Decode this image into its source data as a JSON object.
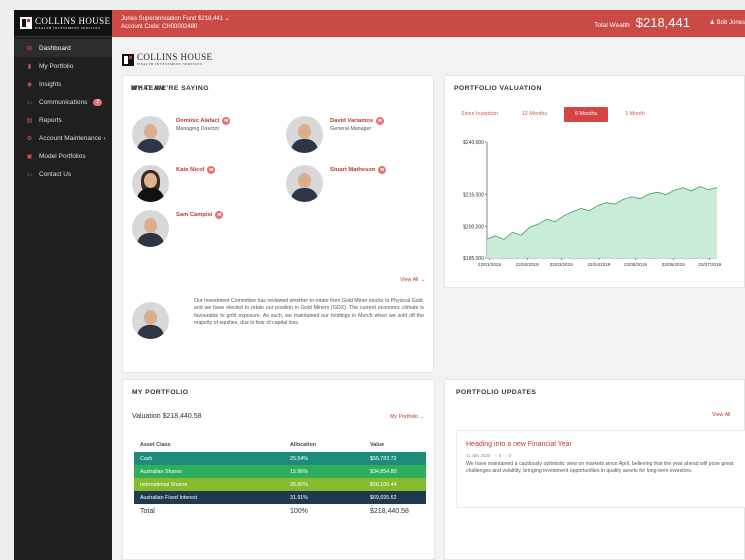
{
  "brand": {
    "name": "COLLINS HOUSE",
    "tagline": "WEALTH INVESTMENT SERVICES"
  },
  "account": {
    "fund": "Jones Superannuation Fund $218,441 ⌄",
    "code": "Account Code: CH00002480"
  },
  "total_wealth": {
    "label": "Total Wealth",
    "amount": "$218,441"
  },
  "user": "♟ Bob Jones",
  "sidebar": {
    "items": [
      {
        "label": "Dashboard",
        "icon": "grid-icon",
        "glyph": "⊞"
      },
      {
        "label": "My Portfolio",
        "icon": "bar-chart-icon",
        "glyph": "▮"
      },
      {
        "label": "Insights",
        "icon": "eye-icon",
        "glyph": "◉"
      },
      {
        "label": "Communications",
        "icon": "chat-icon",
        "glyph": "▭",
        "badge": "2"
      },
      {
        "label": "Reports",
        "icon": "document-icon",
        "glyph": "▤"
      },
      {
        "label": "Account Maintenance ›",
        "icon": "gear-icon",
        "glyph": "⚙"
      },
      {
        "label": "Model Portfolios",
        "icon": "briefcase-icon",
        "glyph": "▣"
      },
      {
        "label": "Contact Us",
        "icon": "message-icon",
        "glyph": "▭"
      }
    ]
  },
  "team": {
    "title": "MY TEAM",
    "members": [
      {
        "name": "Dominic Alafaci",
        "role": "Managing Director"
      },
      {
        "name": "David Variamos",
        "role": "General Manager"
      },
      {
        "name": "Kate Nicol",
        "role": ""
      },
      {
        "name": "Stuart Matheson",
        "role": ""
      },
      {
        "name": "Sam Campisi",
        "role": ""
      }
    ]
  },
  "saying": {
    "title": "WHAT WE'RE SAYING",
    "view_all": "View All →",
    "text": "Our Investment Committee has reviewed whether to rotate from Gold Miner stocks to Physical Gold, and we have elected to retain our position in Gold Miners (GDX). The current economic climate is favourable to gold exposure. As such, we maintained our holdings in Merch when we sold off the majority of equities, due to fear of capital loss."
  },
  "valuation": {
    "title": "PORTFOLIO VALUATION",
    "tabs": [
      "Since Inception",
      "12 Months",
      "6 Months",
      "1 Month"
    ],
    "active_tab": "6 Months"
  },
  "chart_data": {
    "type": "area",
    "title": "",
    "xlabel": "",
    "ylabel": "",
    "ylim": [
      185000,
      240000
    ],
    "y_ticks": [
      "$240,000",
      "$215,000",
      "$200,000",
      "$185,000"
    ],
    "y_tick_values": [
      240000,
      215000,
      200000,
      185000
    ],
    "x_ticks": [
      "22/01/2019",
      "22/02/2019",
      "22/03/2019",
      "22/04/2019",
      "22/05/2019",
      "22/06/2019",
      "22/07/2019"
    ],
    "color": "#c9ecd6",
    "line_color": "#3a9c6a",
    "grid": false,
    "series": [
      {
        "x": [
          "20/01/2019",
          "27/01/2019",
          "03/02/2019",
          "10/02/2019",
          "17/02/2019",
          "24/02/2019",
          "03/03/2019",
          "10/03/2019",
          "17/03/2019",
          "24/03/2019",
          "31/03/2019",
          "07/04/2019",
          "14/04/2019",
          "21/04/2019",
          "28/04/2019",
          "05/05/2019",
          "12/05/2019",
          "19/05/2019",
          "26/05/2019",
          "02/06/2019",
          "09/06/2019",
          "16/06/2019",
          "23/06/2019",
          "30/06/2019",
          "07/07/2019",
          "14/07/2019",
          "21/07/2019",
          "28/07/2019"
        ],
        "values": [
          194000,
          195500,
          193800,
          197200,
          195800,
          199500,
          201000,
          203400,
          202200,
          205000,
          206800,
          208500,
          207400,
          209800,
          211200,
          210500,
          212800,
          214000,
          213100,
          215300,
          216200,
          215000,
          217200,
          218300,
          216800,
          218900,
          217400,
          218441
        ]
      }
    ]
  },
  "portfolio": {
    "title": "MY PORTFOLIO",
    "valuation": "Valuation $218,440.58",
    "link": "My Portfolio →",
    "headers": [
      "Asset Class",
      "Allocation",
      "Value"
    ],
    "rows": [
      {
        "asset": "Cash",
        "allocation": "25.54%",
        "value": "$55,783.72",
        "color": "#1e8c7a"
      },
      {
        "asset": "Australian Shares",
        "allocation": "15.96%",
        "value": "$34,854.80",
        "color": "#2eae5c"
      },
      {
        "asset": "International Shares",
        "allocation": "26.60%",
        "value": "$58,106.44",
        "color": "#86bb2d"
      },
      {
        "asset": "Australian Fixed Interest",
        "allocation": "31.91%",
        "value": "$69,695.62",
        "color": "#1f3a4f"
      }
    ],
    "total": {
      "label": "Total",
      "allocation": "100%",
      "value": "$218,440.58"
    }
  },
  "updates": {
    "title": "PORTFOLIO UPDATES",
    "view_all": "View All",
    "item": {
      "title": "Heading into a new Financial Year",
      "meta": "11 July 2020 · ♡ 0 · ◌ 0",
      "body": "We have maintained a cautiously optimistic view on markets since April, believing that the year ahead will pose great challenges and volatility, bringing investment opportunities in quality assets for long-term investors."
    }
  }
}
